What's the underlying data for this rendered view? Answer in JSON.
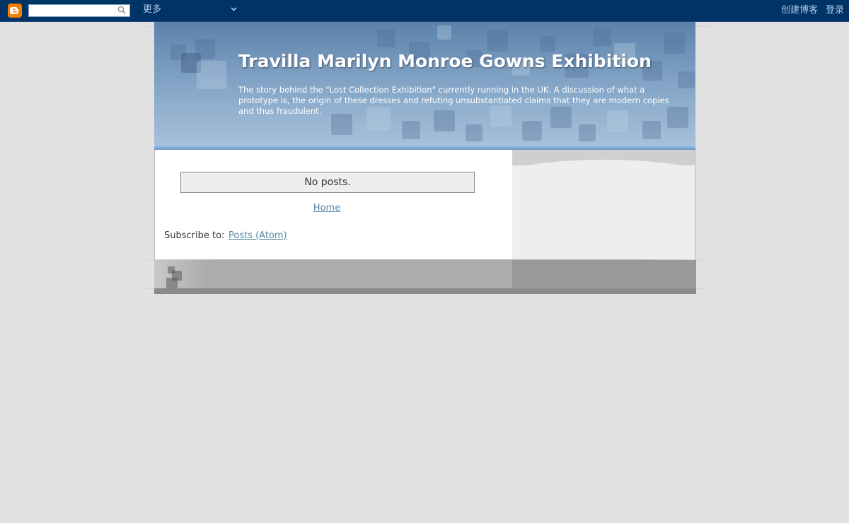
{
  "navbar": {
    "more_label": "更多",
    "create_blog_label": "创建博客",
    "signin_label": "登录",
    "search_value": "",
    "icons": {
      "logo": "blogger-logo-icon",
      "search": "search-icon",
      "dropdown": "chevron-down-icon"
    }
  },
  "header": {
    "title": "Travilla Marilyn Monroe Gowns Exhibition",
    "description": "The story behind the \"Lost Collection Exhibition\" currently running in the UK. A discussion of what a prototype is, the origin of these dresses and refuting unsubstantiated claims that they are modern copies and thus fraudulent."
  },
  "main": {
    "status_message": "No posts.",
    "home_link": "Home",
    "subscribe_label": "Subscribe to:",
    "subscribe_link": "Posts (Atom)"
  },
  "colors": {
    "navbar": "#003366",
    "link": "#5588aa",
    "page_bg": "#e1e1e1"
  }
}
